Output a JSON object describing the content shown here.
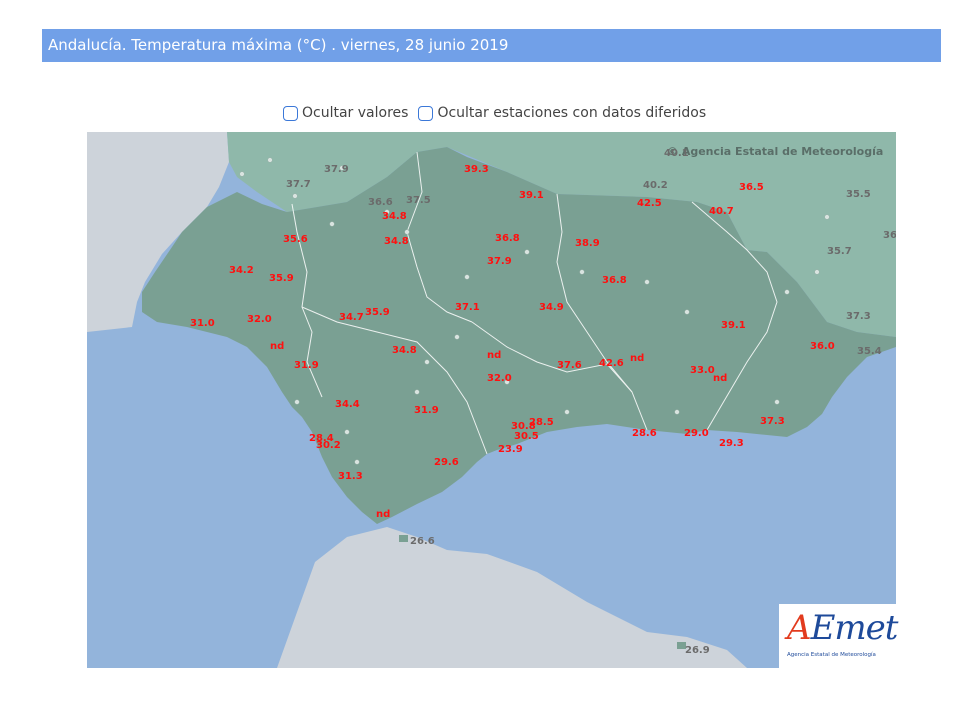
{
  "header": {
    "title": "Andalucía. Temperatura máxima (°C) . viernes, 28 junio 2019"
  },
  "controls": {
    "hide_values": "Ocultar valores",
    "hide_deferred": "Ocultar estaciones con datos diferidos"
  },
  "map": {
    "credit": "© Agencia Estatal de Meteorología",
    "logo_text": "AEmet",
    "logo_subtitle": "Agencia Estatal de Meteorología",
    "colors": {
      "sea": "#93b4db",
      "land_other": "#cdd3da",
      "neighbor": "#8fb8aa",
      "andalucia": "#7aa093",
      "borders": "#ffffff",
      "value_red": "#ff1010",
      "value_grey": "#6b6b6b"
    },
    "stations": [
      {
        "v": "39.3",
        "c": "red"
      },
      {
        "v": "39.1",
        "c": "red"
      },
      {
        "v": "34.8",
        "c": "red"
      },
      {
        "v": "34.8",
        "c": "red"
      },
      {
        "v": "35.6",
        "c": "red"
      },
      {
        "v": "36.8",
        "c": "red"
      },
      {
        "v": "38.9",
        "c": "red"
      },
      {
        "v": "42.5",
        "c": "red"
      },
      {
        "v": "40.7",
        "c": "red"
      },
      {
        "v": "36.5",
        "c": "red"
      },
      {
        "v": "34.2",
        "c": "red"
      },
      {
        "v": "35.9",
        "c": "red"
      },
      {
        "v": "37.9",
        "c": "red"
      },
      {
        "v": "36.8",
        "c": "red"
      },
      {
        "v": "31.0",
        "c": "red"
      },
      {
        "v": "32.0",
        "c": "red"
      },
      {
        "v": "34.7",
        "c": "red"
      },
      {
        "v": "35.9",
        "c": "red"
      },
      {
        "v": "37.1",
        "c": "red"
      },
      {
        "v": "34.9",
        "c": "red"
      },
      {
        "v": "39.1",
        "c": "red"
      },
      {
        "v": "nd",
        "c": "red"
      },
      {
        "v": "34.8",
        "c": "red"
      },
      {
        "v": "nd",
        "c": "red"
      },
      {
        "v": "36.0",
        "c": "red"
      },
      {
        "v": "31.9",
        "c": "red"
      },
      {
        "v": "32.0",
        "c": "red"
      },
      {
        "v": "37.6",
        "c": "red"
      },
      {
        "v": "42.6",
        "c": "red"
      },
      {
        "v": "nd",
        "c": "red"
      },
      {
        "v": "33.0",
        "c": "red"
      },
      {
        "v": "nd",
        "c": "red"
      },
      {
        "v": "34.4",
        "c": "red"
      },
      {
        "v": "31.9",
        "c": "red"
      },
      {
        "v": "28.5",
        "c": "red"
      },
      {
        "v": "30.8",
        "c": "red"
      },
      {
        "v": "30.5",
        "c": "red"
      },
      {
        "v": "28.4",
        "c": "red"
      },
      {
        "v": "30.2",
        "c": "red"
      },
      {
        "v": "28.6",
        "c": "red"
      },
      {
        "v": "29.0",
        "c": "red"
      },
      {
        "v": "37.3",
        "c": "red"
      },
      {
        "v": "29.3",
        "c": "red"
      },
      {
        "v": "23.9",
        "c": "red"
      },
      {
        "v": "29.6",
        "c": "red"
      },
      {
        "v": "31.3",
        "c": "red"
      },
      {
        "v": "nd",
        "c": "red"
      },
      {
        "v": "37.9",
        "c": "grey"
      },
      {
        "v": "37.7",
        "c": "grey"
      },
      {
        "v": "36.6",
        "c": "grey"
      },
      {
        "v": "37.5",
        "c": "grey"
      },
      {
        "v": "40.2",
        "c": "grey"
      },
      {
        "v": "40.1",
        "c": "grey"
      },
      {
        "v": "35.5",
        "c": "grey"
      },
      {
        "v": "36",
        "c": "grey"
      },
      {
        "v": "35.7",
        "c": "grey"
      },
      {
        "v": "37.3",
        "c": "grey"
      },
      {
        "v": "35.4",
        "c": "grey"
      },
      {
        "v": "26.6",
        "c": "grey"
      },
      {
        "v": "26.9",
        "c": "grey"
      }
    ]
  }
}
